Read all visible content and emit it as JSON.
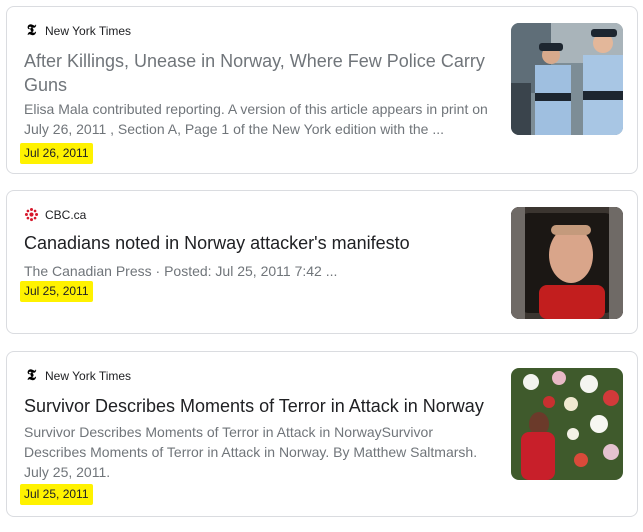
{
  "results": [
    {
      "source": "New York Times",
      "source_icon": "nyt-logo-icon",
      "title": "After Killings, Unease in Norway, Where Few Police Carry Guns",
      "snippet": "Elisa Mala contributed reporting. A version of this article appears in print on July 26, 2011 , Section A, Page 1 of the New York edition with the ...",
      "date": "Jul 26, 2011",
      "thumbnail": "police-officers-image"
    },
    {
      "source": "CBC.ca",
      "source_icon": "cbc-logo-icon",
      "title": "Canadians noted in Norway attacker's manifesto",
      "snippet": "The Canadian Press · Posted: Jul 25, 2011 7:42 ...",
      "date": "Jul 25, 2011",
      "thumbnail": "man-in-car-image"
    },
    {
      "source": "New York Times",
      "source_icon": "nyt-logo-icon",
      "title": "Survivor Describes Moments of Terror in Attack in Norway",
      "snippet": "Survivor Describes Moments of Terror in Attack in NorwaySurvivor Describes Moments of Terror in Attack in Norway. By Matthew Saltmarsh. July 25, 2011.",
      "date": "Jul 25, 2011",
      "thumbnail": "flowers-memorial-image"
    }
  ],
  "highlight_color": "#fff200"
}
